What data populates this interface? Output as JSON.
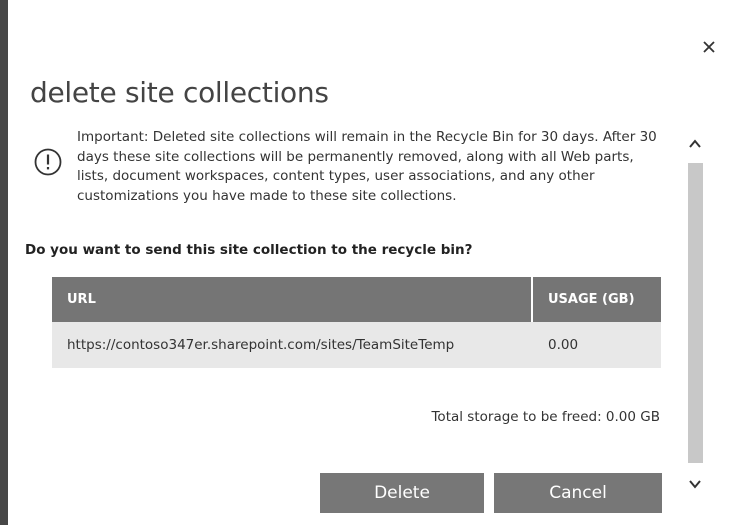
{
  "dialog": {
    "title": "delete site collections",
    "notice_icon": "exclamation-circle-icon",
    "close_icon": "close-icon",
    "notice_text": "Important: Deleted site collections will remain in the Recycle Bin for 30 days. After 30 days these site collections will be permanently removed, along with all Web parts, lists, document workspaces, content types, user associations, and any other customizations you have made to these site collections.",
    "question": "Do you want to send this site collection to the recycle bin?",
    "table": {
      "headers": {
        "url": "URL",
        "usage": "USAGE (GB)"
      },
      "rows": [
        {
          "url": "https://contoso347er.sharepoint.com/sites/TeamSiteTemp",
          "usage": "0.00"
        }
      ]
    },
    "total": "Total storage to be freed: 0.00 GB",
    "buttons": {
      "delete": "Delete",
      "cancel": "Cancel"
    },
    "scrollbar": {
      "up_icon": "chevron-up-icon",
      "down_icon": "chevron-down-icon"
    }
  },
  "colors": {
    "header_bg": "#757575",
    "row_bg": "#e8e8e8",
    "button_bg": "#777777",
    "left_bar": "#474747",
    "scroll_track": "#c8c8c8"
  }
}
